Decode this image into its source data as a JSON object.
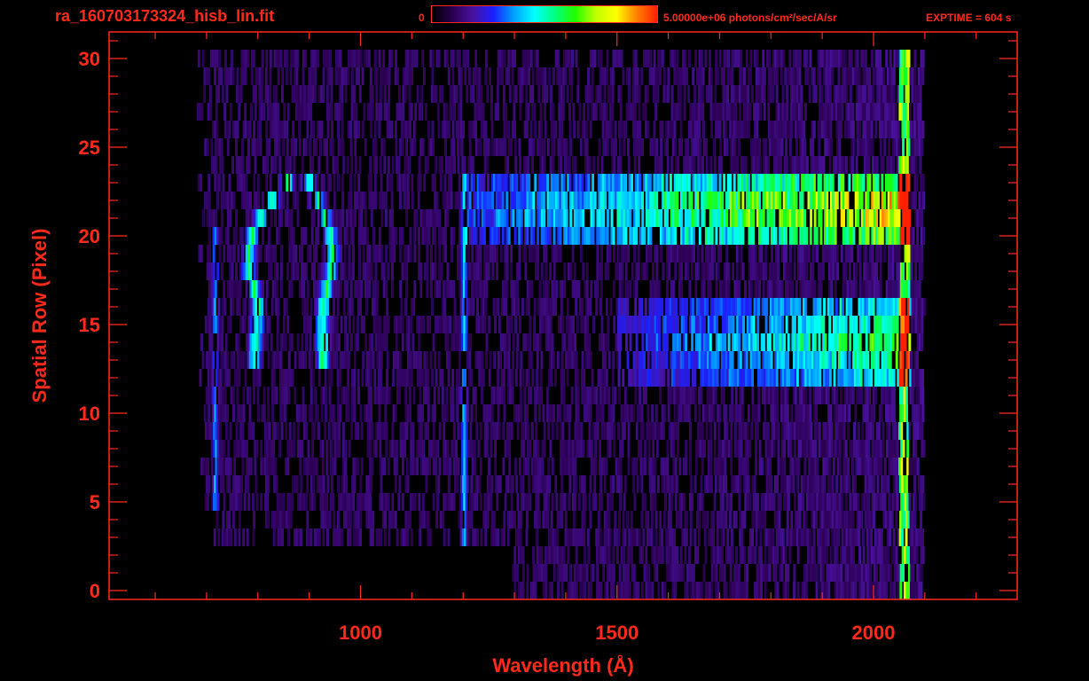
{
  "header": {
    "title": "ra_160703173324_hisb_lin.fit",
    "colorbar_min_label": "0",
    "colorbar_max_label": "5.00000e+06 photons/cm²/sec/A/sr",
    "exptime_label": "EXPTIME = 604 s"
  },
  "colors": {
    "axis": "#ff2a1a",
    "background": "#000000",
    "colormap": [
      "#000000",
      "#2a0050",
      "#4a12a0",
      "#1a20ff",
      "#00a0ff",
      "#00ffff",
      "#00ff80",
      "#20ff00",
      "#c0ff00",
      "#ffff00",
      "#ff8000",
      "#ff2000"
    ]
  },
  "chart_data": {
    "type": "heatmap",
    "title": "ra_160703173324_hisb_lin.fit",
    "xlabel": "Wavelength (Å)",
    "ylabel": "Spatial Row (Pixel)",
    "xlim": [
      510,
      2280
    ],
    "ylim": [
      -0.5,
      31.5
    ],
    "x_ticks": [
      1000,
      1500,
      2000
    ],
    "y_ticks": [
      0,
      5,
      10,
      15,
      20,
      25,
      30
    ],
    "colorbar_range": [
      0,
      5000000
    ],
    "colorbar_units": "photons/cm²/sec/A/sr",
    "data_x_range": [
      680,
      2100
    ],
    "data_rows": [
      0,
      30
    ],
    "features": [
      {
        "kind": "arc",
        "center_wavelength": 880,
        "half_width": 90,
        "row_top": 23,
        "row_bottom": 13,
        "intensity": 0.45
      },
      {
        "kind": "vertical_line",
        "wavelength": 715,
        "rows": [
          5,
          20
        ],
        "intensity": 0.28
      },
      {
        "kind": "vertical_line",
        "wavelength": 1200,
        "rows": [
          3,
          23
        ],
        "intensity": 0.32
      },
      {
        "kind": "band",
        "rows": [
          20,
          23
        ],
        "wavelength_start": 1200,
        "wavelength_end": 2070,
        "peak_intensity": 0.78
      },
      {
        "kind": "band",
        "rows": [
          12,
          16
        ],
        "wavelength_start": 1500,
        "wavelength_end": 2070,
        "peak_intensity": 0.52
      },
      {
        "kind": "edge",
        "wavelength": 2060,
        "rows": [
          0,
          30
        ],
        "intensity": 0.62
      }
    ]
  }
}
